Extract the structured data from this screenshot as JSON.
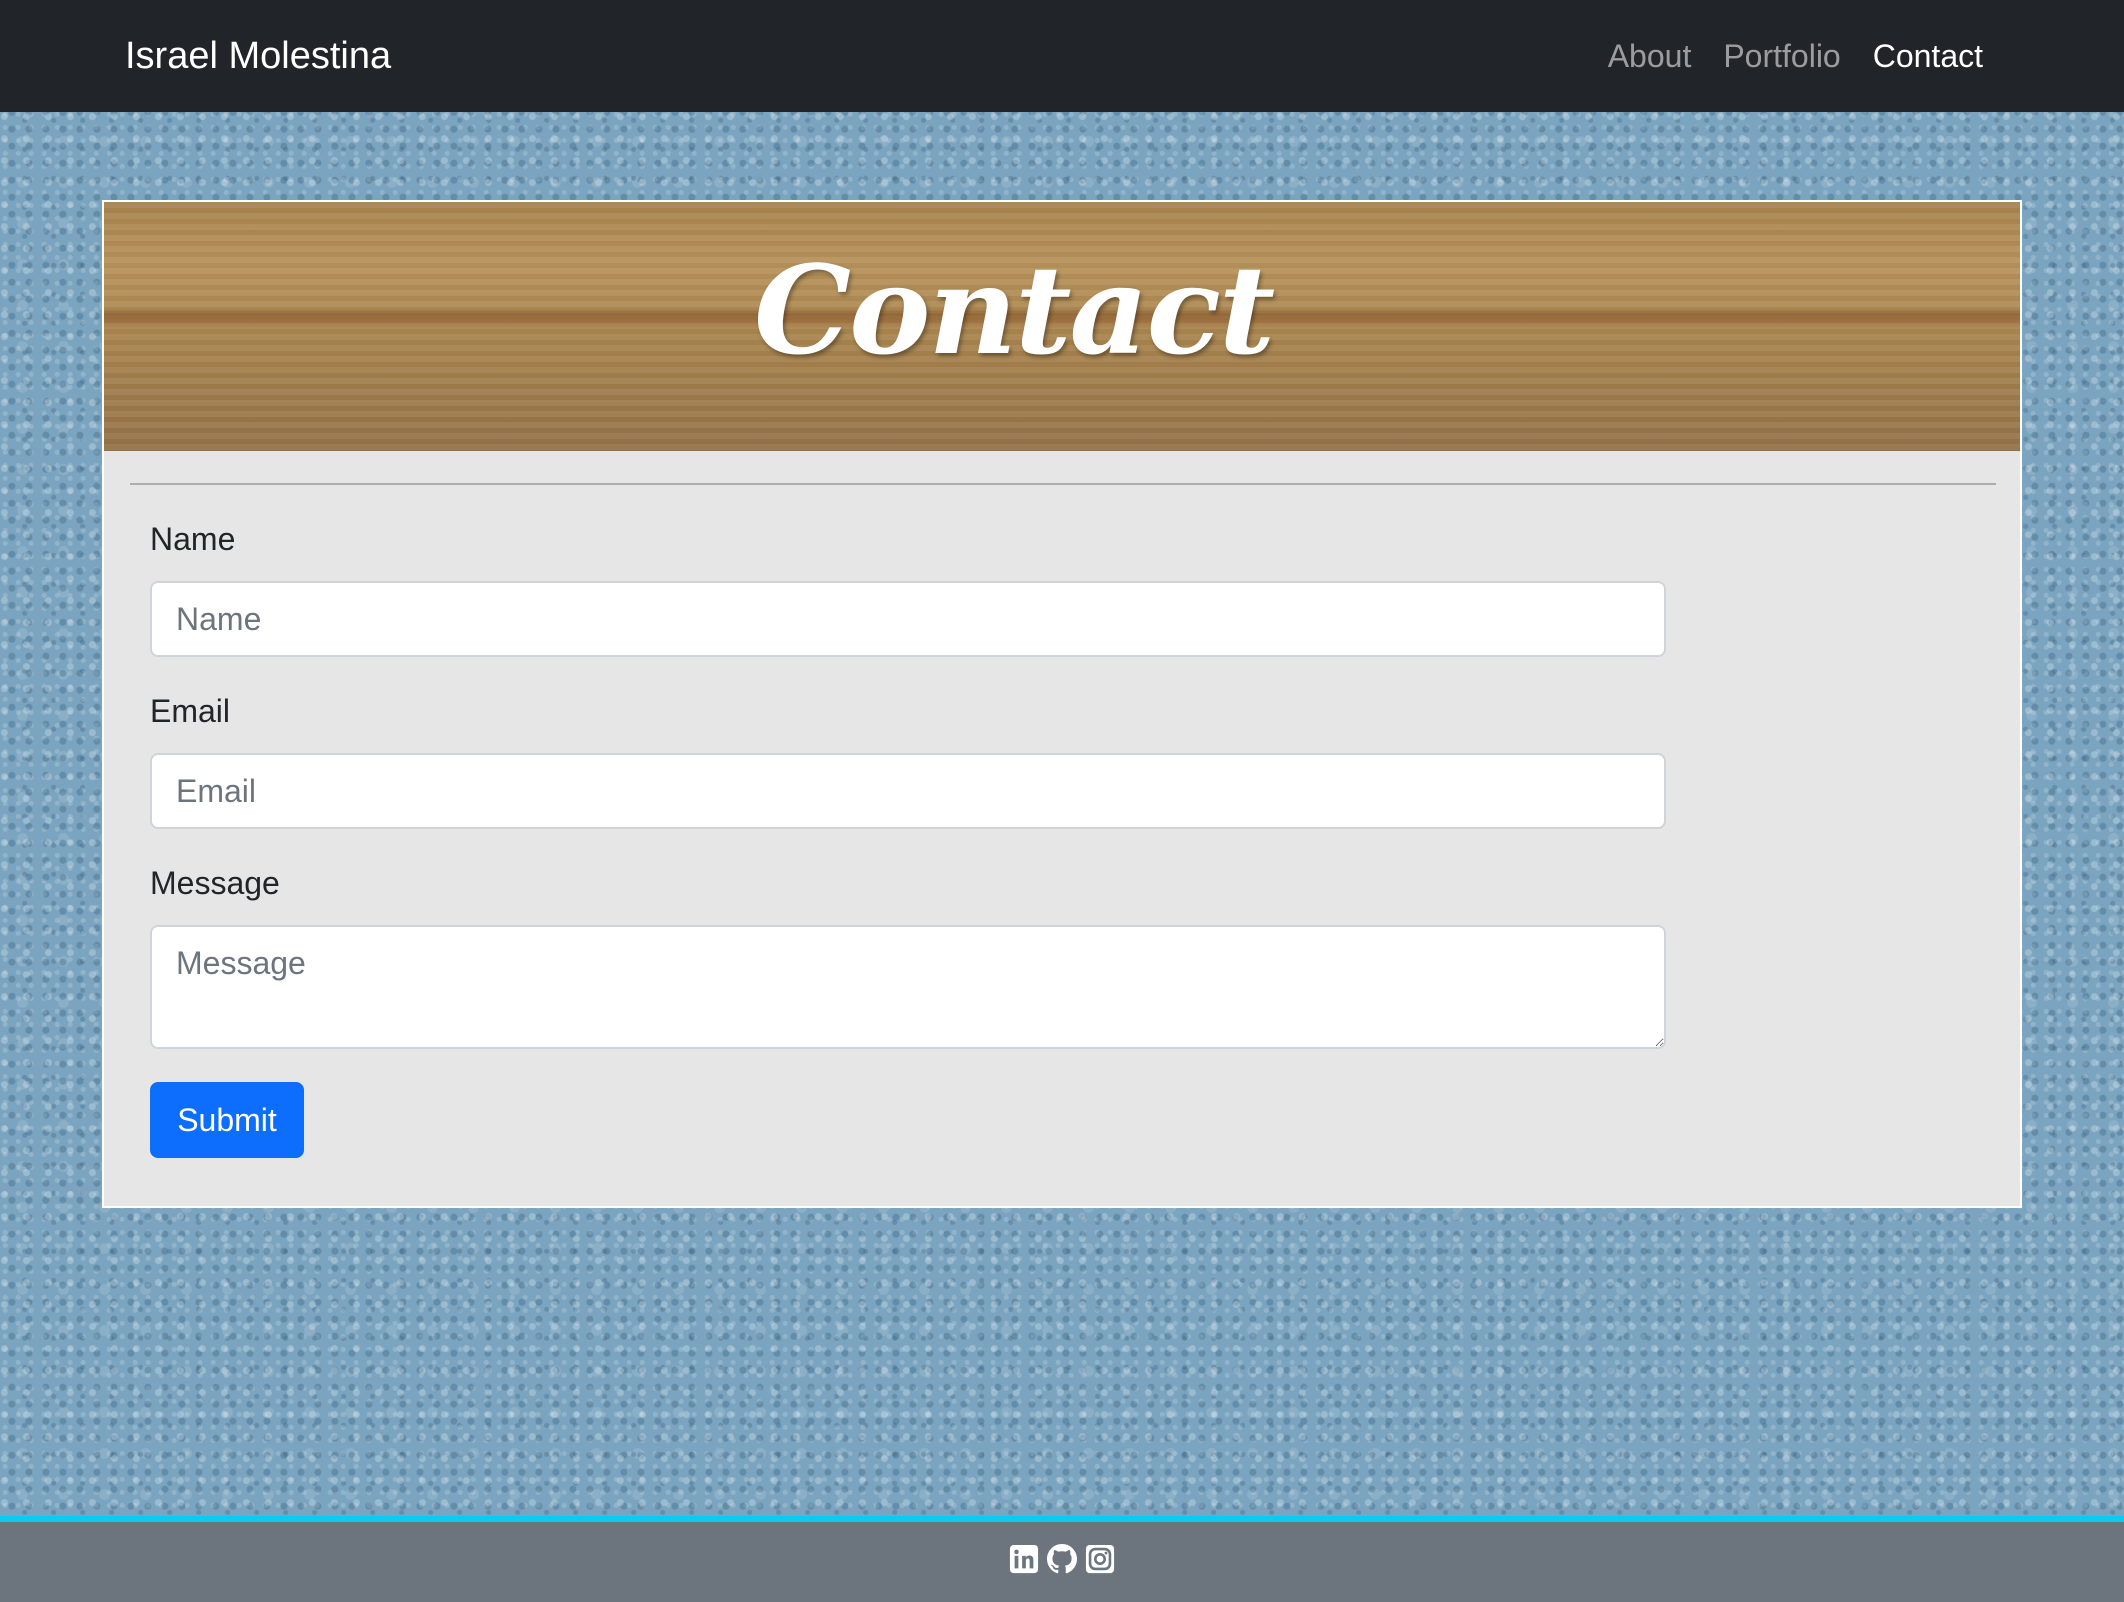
{
  "navbar": {
    "brand": "Israel Molestina",
    "links": [
      {
        "label": "About",
        "active": false
      },
      {
        "label": "Portfolio",
        "active": false
      },
      {
        "label": "Contact",
        "active": true
      }
    ]
  },
  "card": {
    "title": "Contact"
  },
  "form": {
    "name": {
      "label": "Name",
      "placeholder": "Name",
      "value": ""
    },
    "email": {
      "label": "Email",
      "placeholder": "Email",
      "value": ""
    },
    "message": {
      "label": "Message",
      "placeholder": "Message",
      "value": ""
    },
    "submit_label": "Submit"
  },
  "footer": {
    "icons": [
      "linkedin-icon",
      "github-icon",
      "instagram-icon"
    ]
  },
  "colors": {
    "navbar_bg": "#212529",
    "primary": "#0d6efd",
    "footer_bg": "#6c757d",
    "footer_accent": "#0dcaf0",
    "card_bg": "#e6e6e6"
  }
}
